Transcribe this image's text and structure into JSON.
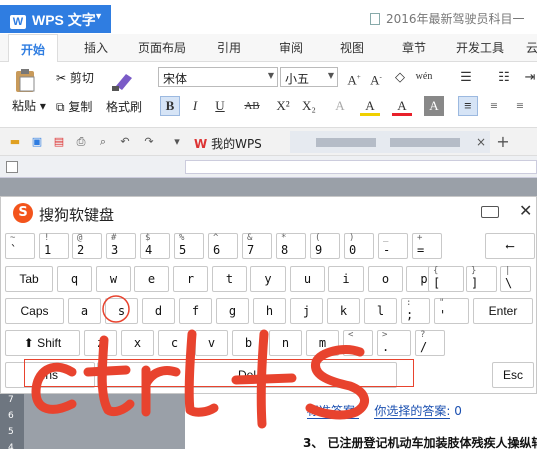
{
  "app": {
    "name": "WPS 文字",
    "doc_title": "2016年最新驾驶员科目一"
  },
  "menu": {
    "tabs": [
      "开始",
      "插入",
      "页面布局",
      "引用",
      "审阅",
      "视图",
      "章节",
      "开发工具",
      "云"
    ]
  },
  "ribbon": {
    "paste": "粘贴",
    "cut": "剪切",
    "copy": "复制",
    "format_painter": "格式刷",
    "font_name": "宋体",
    "font_size": "小五",
    "bold": "B",
    "italic": "I",
    "underline": "U",
    "strike": "AB",
    "superscript": "X²",
    "subscript": "X₂",
    "font_color": "A",
    "highlight": "A"
  },
  "quick": {
    "my_wps_tab": "我的WPS",
    "new_tab": "+"
  },
  "keyboard": {
    "title": "搜狗软键盘",
    "rows": [
      [
        {
          "lo": "`",
          "up": "~"
        },
        {
          "lo": "1",
          "up": "!"
        },
        {
          "lo": "2",
          "up": "@"
        },
        {
          "lo": "3",
          "up": "#"
        },
        {
          "lo": "4",
          "up": "$"
        },
        {
          "lo": "5",
          "up": "%"
        },
        {
          "lo": "6",
          "up": "^"
        },
        {
          "lo": "7",
          "up": "&"
        },
        {
          "lo": "8",
          "up": "*"
        },
        {
          "lo": "9",
          "up": "("
        },
        {
          "lo": "0",
          "up": ")"
        },
        {
          "lo": "-",
          "up": "_"
        },
        {
          "lo": "=",
          "up": "+"
        },
        {
          "lo": "⟵",
          "up": ""
        }
      ],
      [
        {
          "lo": "Tab",
          "up": ""
        },
        {
          "lo": "q",
          "up": ""
        },
        {
          "lo": "w",
          "up": ""
        },
        {
          "lo": "e",
          "up": ""
        },
        {
          "lo": "r",
          "up": ""
        },
        {
          "lo": "t",
          "up": ""
        },
        {
          "lo": "y",
          "up": ""
        },
        {
          "lo": "u",
          "up": ""
        },
        {
          "lo": "i",
          "up": ""
        },
        {
          "lo": "o",
          "up": ""
        },
        {
          "lo": "p",
          "up": ""
        },
        {
          "lo": "[",
          "up": "{"
        },
        {
          "lo": "]",
          "up": "}"
        },
        {
          "lo": "\\",
          "up": "|"
        }
      ],
      [
        {
          "lo": "Caps",
          "up": ""
        },
        {
          "lo": "a",
          "up": ""
        },
        {
          "lo": "s",
          "up": ""
        },
        {
          "lo": "d",
          "up": ""
        },
        {
          "lo": "f",
          "up": ""
        },
        {
          "lo": "g",
          "up": ""
        },
        {
          "lo": "h",
          "up": ""
        },
        {
          "lo": "j",
          "up": ""
        },
        {
          "lo": "k",
          "up": ""
        },
        {
          "lo": "l",
          "up": ""
        },
        {
          "lo": ";",
          "up": ":"
        },
        {
          "lo": "'",
          "up": "\""
        },
        {
          "lo": "Enter",
          "up": ""
        }
      ],
      [
        {
          "lo": "⬆ Shift",
          "up": ""
        },
        {
          "lo": "z",
          "up": ""
        },
        {
          "lo": "x",
          "up": ""
        },
        {
          "lo": "c",
          "up": ""
        },
        {
          "lo": "v",
          "up": ""
        },
        {
          "lo": "b",
          "up": ""
        },
        {
          "lo": "n",
          "up": ""
        },
        {
          "lo": "m",
          "up": ""
        },
        {
          "lo": ",",
          "up": "<"
        },
        {
          "lo": ".",
          "up": ">"
        },
        {
          "lo": "/",
          "up": "?"
        }
      ],
      [
        {
          "lo": "Ins",
          "up": ""
        },
        {
          "lo": "Del",
          "up": ""
        },
        {
          "lo": "Esc",
          "up": ""
        }
      ]
    ]
  },
  "document": {
    "answer_label": "标准答案:",
    "answer_chosen_label": "你选择的答案:",
    "answer_value": "0",
    "question": "3、 已注册登记机动车加装肢体残疾人操纵辅"
  },
  "annotation": {
    "text": "ctrl+S",
    "color": "#e8432e",
    "highlighted_key": "s"
  },
  "colors": {
    "accent": "#2f7de1",
    "brand": "#f3541c"
  }
}
